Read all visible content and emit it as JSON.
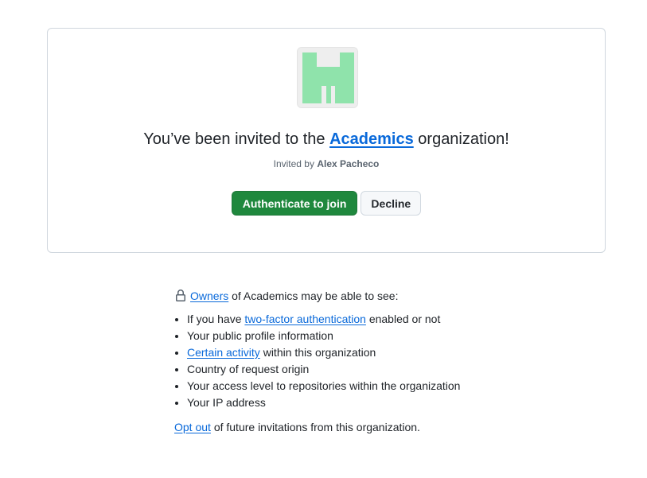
{
  "invite": {
    "prefix": "You’ve been invited to the",
    "org_name": "Academics",
    "suffix": "organization!",
    "invited_by_label": "Invited by",
    "inviter": "Alex Pacheco",
    "primary_button": "Authenticate to join",
    "decline_button": "Decline"
  },
  "privacy": {
    "owners_link": "Owners",
    "owners_text": "of Academics may be able to see:",
    "items": [
      {
        "pre": "If you have",
        "link": "two-factor authentication",
        "post": "enabled or not"
      },
      {
        "pre": "",
        "link": "",
        "post": "Your public profile information"
      },
      {
        "pre": "",
        "link": "Certain activity",
        "post": "within this organization"
      },
      {
        "pre": "",
        "link": "",
        "post": "Country of request origin"
      },
      {
        "pre": "",
        "link": "",
        "post": "Your access level to repositories within the organization"
      },
      {
        "pre": "",
        "link": "",
        "post": "Your IP address"
      }
    ],
    "optout_link": "Opt out",
    "optout_text": "of future invitations from this organization."
  },
  "colors": {
    "primary": "#1f883d",
    "link": "#0969da",
    "avatar_green": "#8fe3ab"
  },
  "icons": {
    "lock": "lock-icon",
    "org_avatar": "identicon"
  }
}
